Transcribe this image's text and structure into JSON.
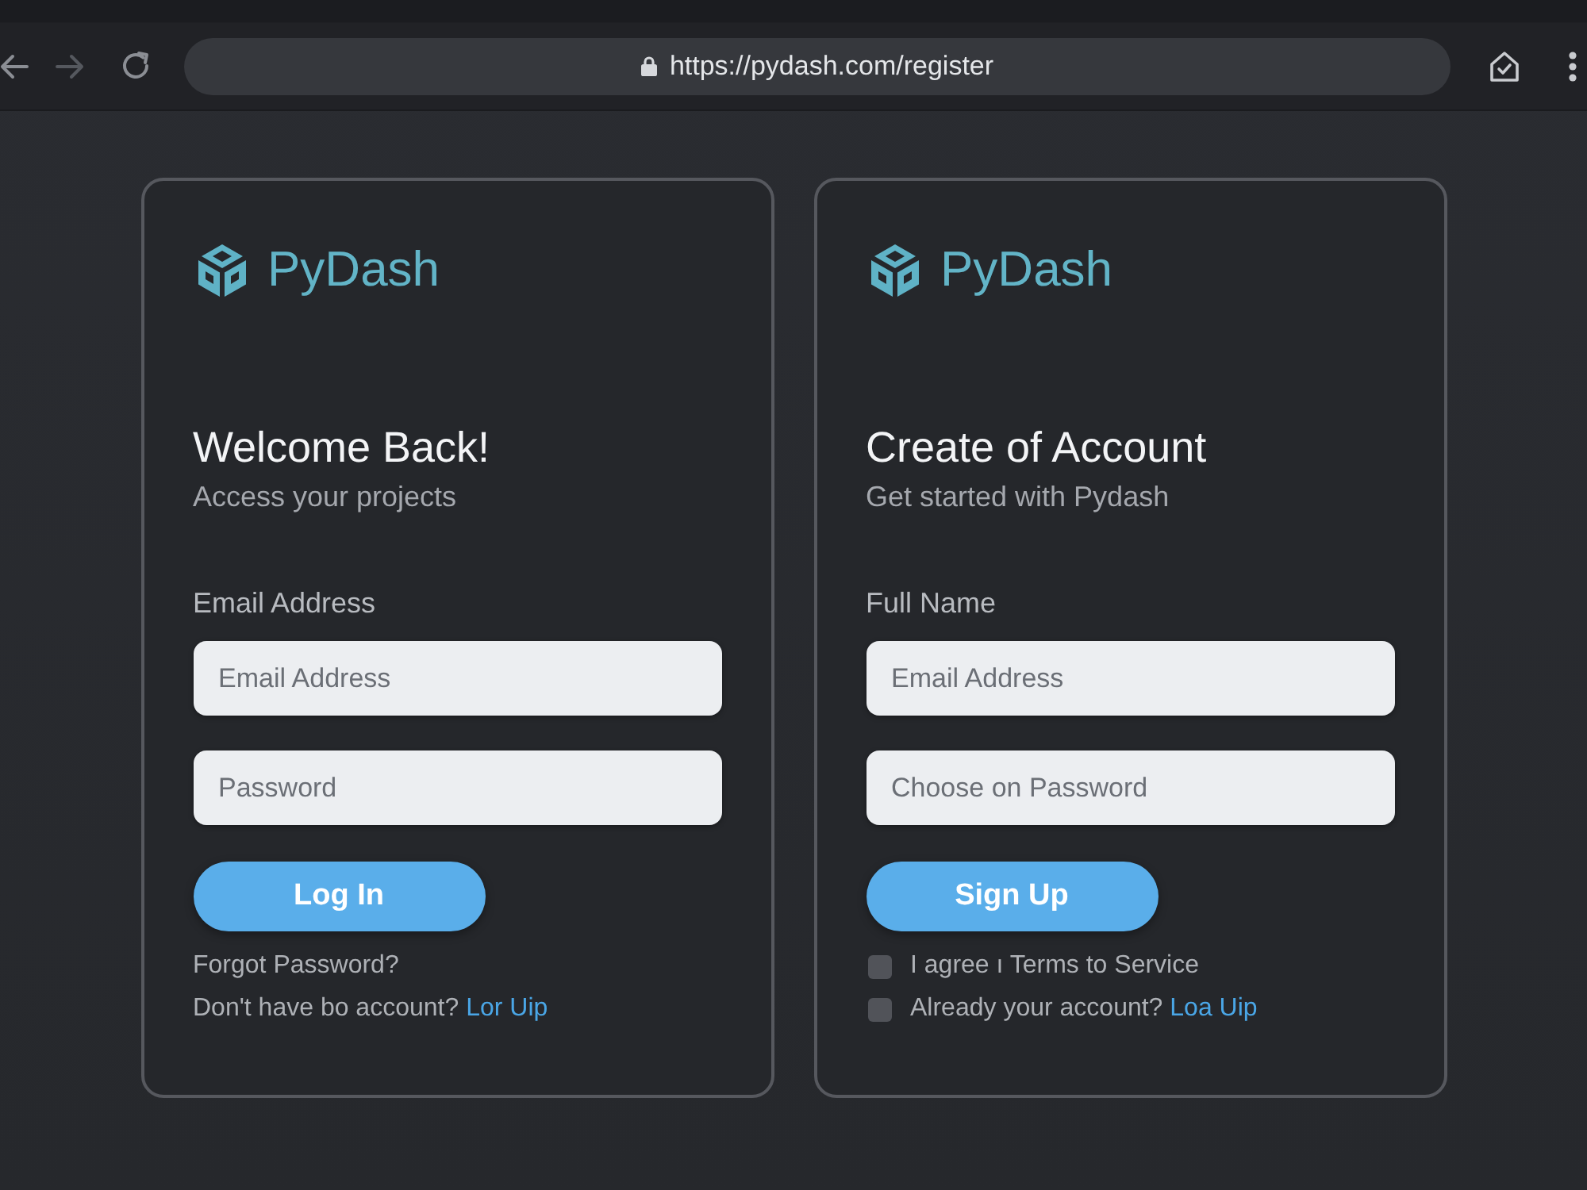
{
  "browser": {
    "url": "https://pydash.com/register",
    "secure": true,
    "can_go_forward": false
  },
  "cards": [
    {
      "brand": "PyDash",
      "title": "Welcome Back!",
      "subtitle": "Access your projects",
      "field_label": "Email Address",
      "fields": [
        {
          "placeholder": "Email Address"
        },
        {
          "placeholder": "Password"
        }
      ],
      "button": "Log In",
      "footer": [
        {
          "kind": "text",
          "text": "Forgot Password?"
        },
        {
          "kind": "prompt",
          "text": "Don't have bo account?",
          "link": "Lor Uip"
        }
      ]
    },
    {
      "brand": "PyDash",
      "title": "Create of Account",
      "subtitle": "Get started with Pydash",
      "field_label": "Full Name",
      "fields": [
        {
          "placeholder": "Email Address"
        },
        {
          "placeholder": "Choose on Password"
        }
      ],
      "button": "Sign Up",
      "footer": [
        {
          "kind": "checkbox",
          "checked": false,
          "text": "I agree ı Terms to Service"
        },
        {
          "kind": "checkbox",
          "checked": false,
          "text": "Already your account?",
          "link": "Loa Uip"
        }
      ]
    }
  ]
}
